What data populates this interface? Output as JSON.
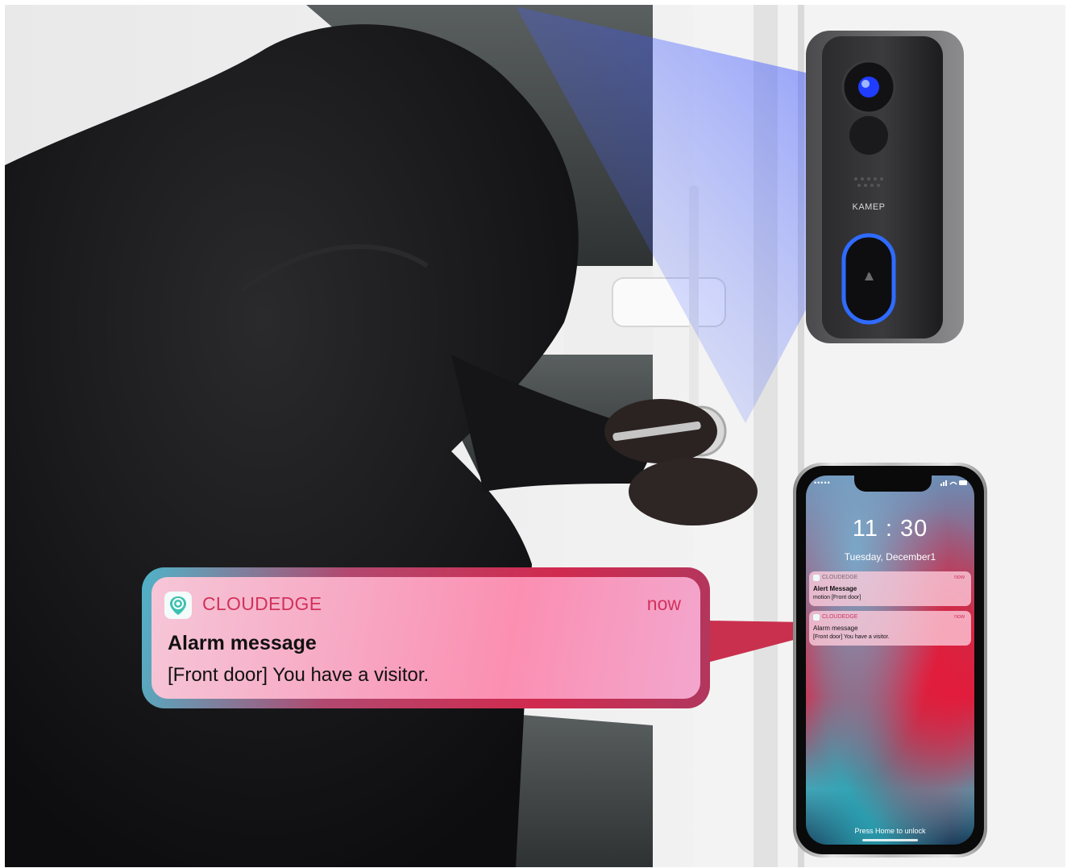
{
  "doorbell": {
    "brand": "KAMEP"
  },
  "notification": {
    "app_name": "CLOUDEDGE",
    "time": "now",
    "title": "Alarm message",
    "body": "[Front door] You have a visitor.",
    "app_icon": "cloudedge-icon"
  },
  "phone": {
    "clock": "11 : 30",
    "date": "Tuesday, December1",
    "carrier": "•••••",
    "notifications": [
      {
        "app_name": "CLOUDEDGE",
        "time": "now",
        "title": "Alert Message",
        "body": "motion [Front door]"
      },
      {
        "app_name": "CLOUDEDGE",
        "time": "now",
        "title": "Alarm message",
        "body": "[Front door] You have a visitor."
      }
    ],
    "unlock_hint": "Press Home to unlock"
  },
  "colors": {
    "accent_pink": "#d1325c",
    "notification_bg": "#f7a9c4",
    "doorbell_ring": "#2f6bff"
  }
}
